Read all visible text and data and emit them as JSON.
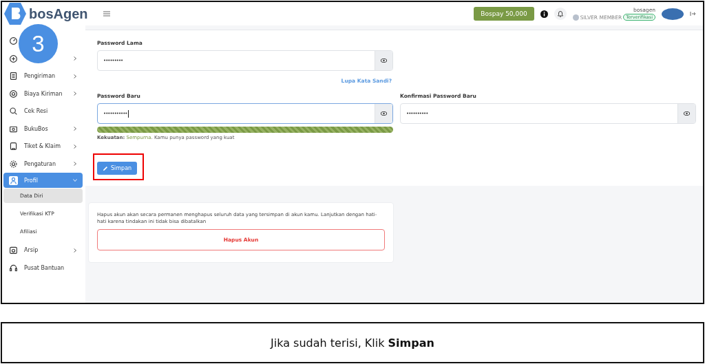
{
  "step_badge": "3",
  "header": {
    "logo": "bosAgen",
    "balance_button": "Bospay  50,000",
    "username": "bosagen",
    "membership": "SILVER MEMBER",
    "verified_badge": "Terverifikasi"
  },
  "sidebar": {
    "items": [
      {
        "kind": "link",
        "selected": false
      },
      {
        "kind": "group",
        "expanded": false,
        "selected": false
      },
      {
        "kind": "group",
        "label": "Pengiriman",
        "expanded": false,
        "selected": false
      },
      {
        "kind": "group",
        "label": "Biaya Kiriman",
        "expanded": false,
        "selected": false
      },
      {
        "kind": "link",
        "label": "Cek Resi",
        "selected": false
      },
      {
        "kind": "group",
        "label": "BukuBos",
        "expanded": false,
        "selected": false
      },
      {
        "kind": "group",
        "label": "Tiket & Klaim",
        "expanded": false,
        "selected": false
      },
      {
        "kind": "group",
        "label": "Pengaturan",
        "expanded": false,
        "selected": false
      },
      {
        "kind": "group",
        "label": "Profil",
        "expanded": true,
        "selected": true,
        "children": [
          {
            "label": "Data Diri",
            "selected": true
          },
          {
            "label": "Verifikasi KTP",
            "selected": false
          },
          {
            "label": "Afiliasi",
            "selected": false
          }
        ]
      },
      {
        "kind": "group",
        "label": "Arsip",
        "expanded": false,
        "selected": false
      },
      {
        "kind": "link",
        "label": "Pusat Bantuan",
        "selected": false
      }
    ]
  },
  "password_form": {
    "old_password": {
      "label": "Password Lama",
      "value": "•••••••••",
      "focused": false
    },
    "forgot_link": "Lupa Kata Sandi?",
    "new_password": {
      "label": "Password Baru",
      "value": "•••••••••••",
      "focused": true
    },
    "confirm_password": {
      "label": "Konfirmasi Password Baru",
      "value": "••••••••••",
      "focused": false
    },
    "strength": {
      "level": 1,
      "prefix": "Kekuatan:",
      "rating": "Sempurna",
      "message": ". Kamu punya password yang kuat"
    },
    "save_button": "Simpan",
    "save_highlighted": true
  },
  "delete_account": {
    "warning": "Hapus akun akan secara permanen menghapus seluruh data yang tersimpan di akun kamu. Lanjutkan dengan hati-hati karena tindakan ini tidak bisa dibatalkan",
    "button": "Hapus Akun"
  },
  "caption": "Jika sudah terisi, Klik **Simpan**"
}
